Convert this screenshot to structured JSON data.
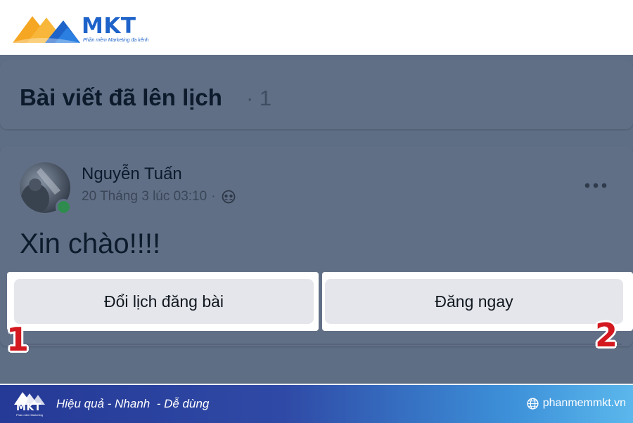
{
  "brand": {
    "name": "MKT",
    "tagline": "Phần mềm Marketing đa kênh",
    "colors": {
      "blue": "#1e63c9",
      "orange": "#f5a623"
    }
  },
  "section": {
    "title": "Bài viết đã lên lịch",
    "count": "· 1"
  },
  "post": {
    "author": "Nguyễn Tuấn",
    "timestamp": "20 Tháng 3 lúc 03:10",
    "separator": "·",
    "audience_icon": "friends-icon",
    "more_icon": "more-horizontal-icon",
    "text": "Xin chào!!!!"
  },
  "actions": {
    "reschedule_label": "Đổi lịch đăng bài",
    "publish_label": "Đăng ngay"
  },
  "annotations": {
    "step1": "1",
    "step2": "2",
    "badge_color": "#d3181f"
  },
  "footer": {
    "logo_text": "MKT",
    "logo_tag": "Phần mềm Marketing",
    "slogan": "Hiệu quả - Nhanh  - Dễ dùng",
    "website": "phanmemmkt.vn",
    "website_icon": "globe-icon"
  }
}
